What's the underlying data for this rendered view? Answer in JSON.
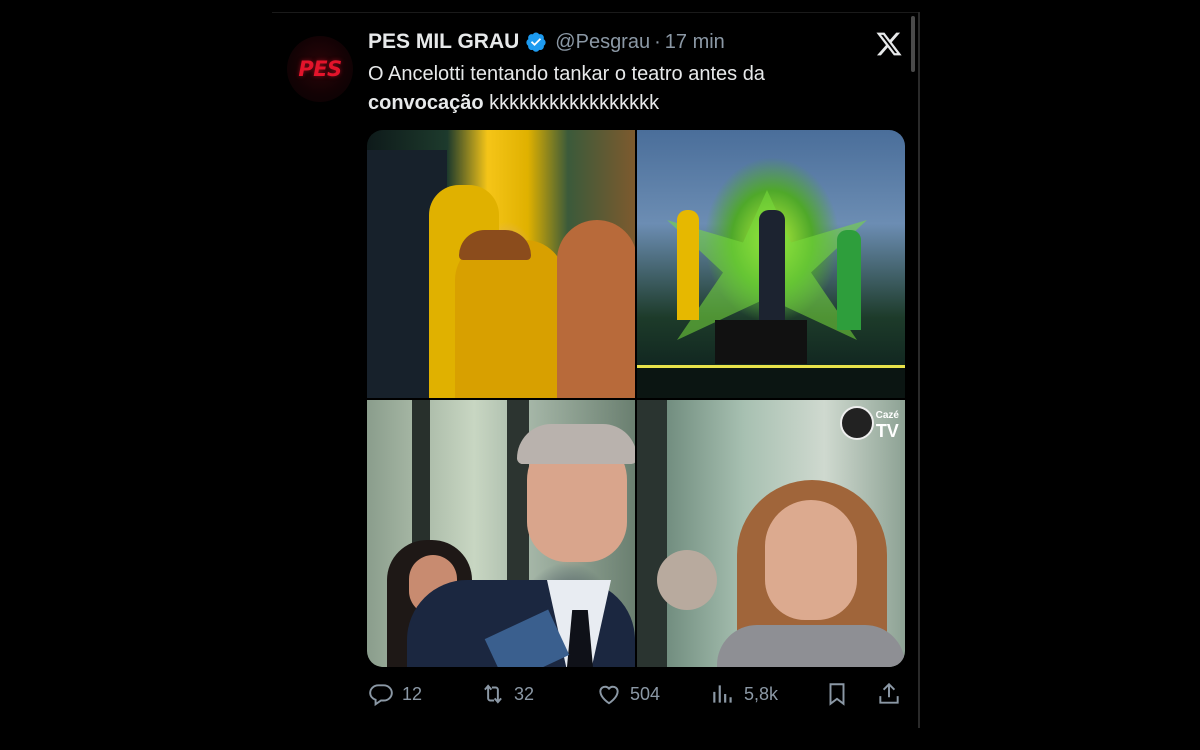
{
  "tweet": {
    "display_name": "PES MIL GRAU",
    "handle": "@Pesgrau",
    "separator": "·",
    "time": "17 min",
    "avatar_text": "PES",
    "text_line1": "O Ancelotti tentando tankar o teatro antes da",
    "text_bold": "convocação",
    "text_rest": " kkkkkkkkkkkkkkkkk",
    "watermark_line1": "Cazé",
    "watermark_line2": "TV"
  },
  "actions": {
    "replies": "12",
    "retweets": "32",
    "likes": "504",
    "views": "5,8k"
  },
  "colors": {
    "background": "#000000",
    "text": "#e7e9ea",
    "secondary": "#8b98a5",
    "verified": "#1d9bf0",
    "brand_red": "#e3142b"
  },
  "icons": {
    "verified": "verified-badge-icon",
    "x_logo": "x-logo-icon",
    "reply": "reply-icon",
    "retweet": "retweet-icon",
    "like": "heart-icon",
    "views": "views-chart-icon",
    "bookmark": "bookmark-icon",
    "share": "share-icon"
  }
}
